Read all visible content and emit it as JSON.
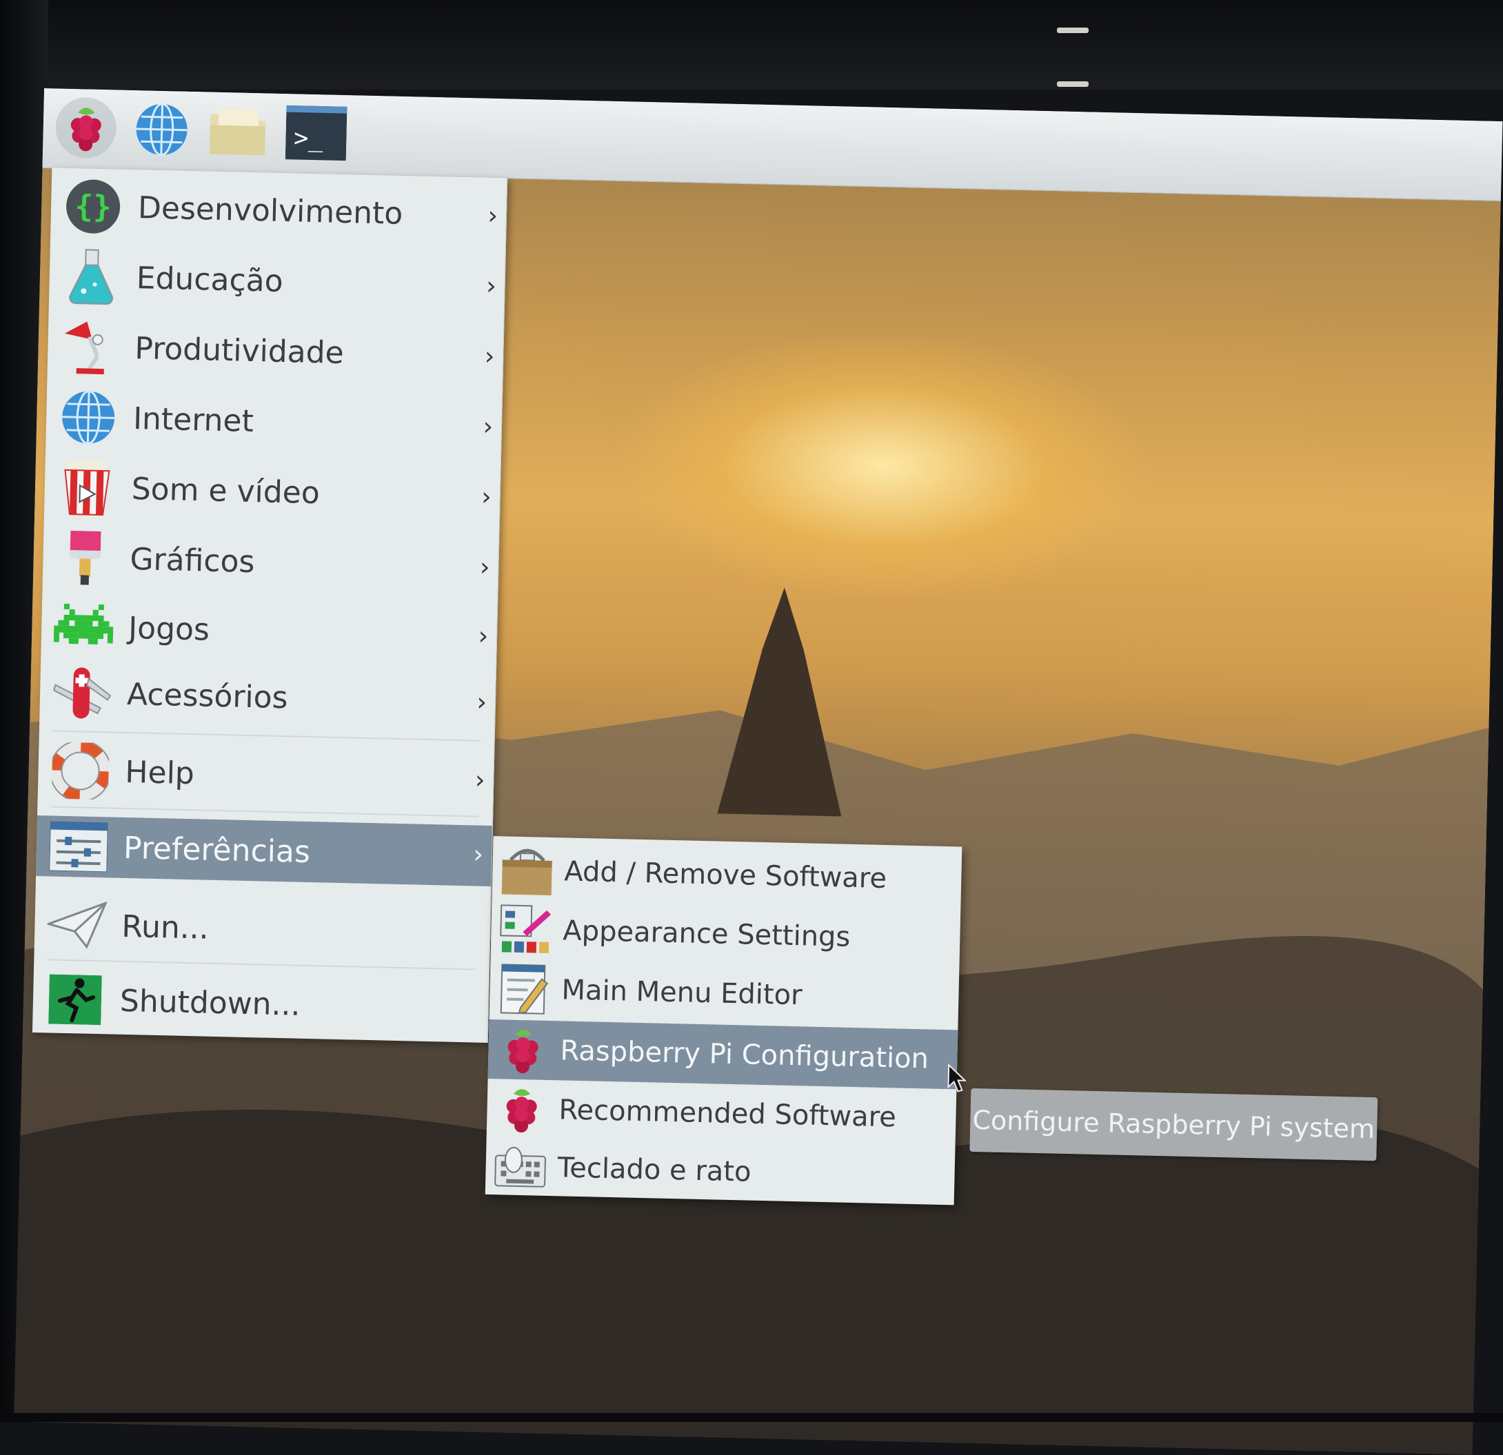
{
  "panel": {
    "launchers": [
      {
        "icon": "raspberry-menu-icon"
      },
      {
        "icon": "web-browser-icon"
      },
      {
        "icon": "file-manager-icon"
      },
      {
        "icon": "terminal-icon"
      }
    ],
    "terminal_prompt": ">_"
  },
  "menu": {
    "items": [
      {
        "label": "Desenvolvimento",
        "icon": "programming-icon",
        "arrow": "›"
      },
      {
        "label": "Educação",
        "icon": "education-flask-icon",
        "arrow": "›"
      },
      {
        "label": "Produtividade",
        "icon": "desk-lamp-icon",
        "arrow": "›"
      },
      {
        "label": "Internet",
        "icon": "globe-icon",
        "arrow": "›"
      },
      {
        "label": "Som e vídeo",
        "icon": "popcorn-icon",
        "arrow": "›"
      },
      {
        "label": "Gráficos",
        "icon": "paintbrush-icon",
        "arrow": "›"
      },
      {
        "label": "Jogos",
        "icon": "space-invader-icon",
        "arrow": "›"
      },
      {
        "label": "Acessórios",
        "icon": "swiss-knife-icon",
        "arrow": "›"
      },
      {
        "label": "Help",
        "icon": "lifebuoy-icon",
        "arrow": "›"
      },
      {
        "label": "Preferências",
        "icon": "preferences-icon",
        "arrow": "›"
      },
      {
        "label": "Run...",
        "icon": "paper-plane-icon"
      },
      {
        "label": "Shutdown...",
        "icon": "exit-icon"
      }
    ]
  },
  "submenu": {
    "items": [
      {
        "label": "Add / Remove Software",
        "icon": "package-icon"
      },
      {
        "label": "Appearance Settings",
        "icon": "appearance-icon"
      },
      {
        "label": "Main Menu Editor",
        "icon": "menu-editor-icon"
      },
      {
        "label": "Raspberry Pi Configuration",
        "icon": "raspberry-icon"
      },
      {
        "label": "Recommended Software",
        "icon": "raspberry-icon"
      },
      {
        "label": "Teclado e rato",
        "icon": "keyboard-mouse-icon"
      }
    ]
  },
  "tooltip": {
    "text": "Configure Raspberry Pi system"
  },
  "colors": {
    "menu_bg": "#e6ebec",
    "selection": "#7e8fa0",
    "text": "#3a3e42",
    "raspberry": "#c51a4a",
    "leaf": "#6cc04a"
  }
}
